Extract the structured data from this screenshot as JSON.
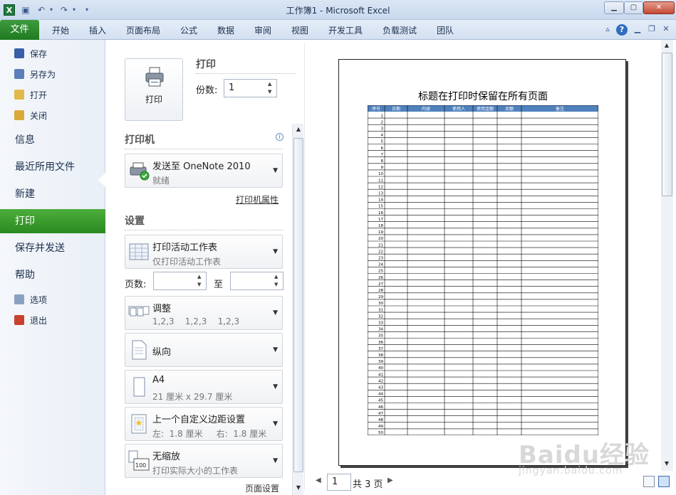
{
  "window": {
    "title": "工作簿1 - Microsoft Excel"
  },
  "ribbon": {
    "file_tab": "文件",
    "tabs": [
      "开始",
      "插入",
      "页面布局",
      "公式",
      "数据",
      "审阅",
      "视图",
      "开发工具",
      "负载测试",
      "团队"
    ]
  },
  "nav": {
    "save": "保存",
    "save_as": "另存为",
    "open": "打开",
    "close": "关闭",
    "info": "信息",
    "recent": "最近所用文件",
    "new": "新建",
    "print": "打印",
    "save_send": "保存并发送",
    "help": "帮助",
    "options": "选项",
    "exit": "退出"
  },
  "print": {
    "button_label": "打印",
    "section_title": "打印",
    "copies_label": "份数:",
    "copies_value": "1"
  },
  "printer": {
    "section_title": "打印机",
    "name": "发送至 OneNote 2010",
    "status": "就绪",
    "properties_link": "打印机属性"
  },
  "settings": {
    "section_title": "设置",
    "scope_main": "打印活动工作表",
    "scope_sub": "仅打印活动工作表",
    "pages_label": "页数:",
    "to_label": "至",
    "collate_main": "调整",
    "collate_sub": "1,2,3    1,2,3    1,2,3",
    "orientation": "纵向",
    "paper_main": "A4",
    "paper_sub": "21 厘米 x 29.7 厘米",
    "margins_main": "上一个自定义边距设置",
    "margins_sub": "左:  1.8 厘米     右:  1.8 厘米",
    "scaling_main": "无缩放",
    "scaling_sub": "打印实际大小的工作表",
    "scaling_icon_text": "100",
    "page_setup_link": "页面设置"
  },
  "preview": {
    "sheet_title": "标题在打印时保留在所有页面",
    "headers": [
      "序号",
      "日期",
      "内容",
      "使用人",
      "使用金额",
      "余额",
      "备注"
    ],
    "row_count": 50,
    "current_page": "1",
    "total_pages": "共 3 页"
  },
  "watermark": {
    "text": "Baidu经验",
    "sub": "jingyan.baidu.com"
  },
  "colors": {
    "file_tab": "#2b8a22",
    "header_fill": "#4f81bd",
    "accent": "#3a6ab0"
  }
}
